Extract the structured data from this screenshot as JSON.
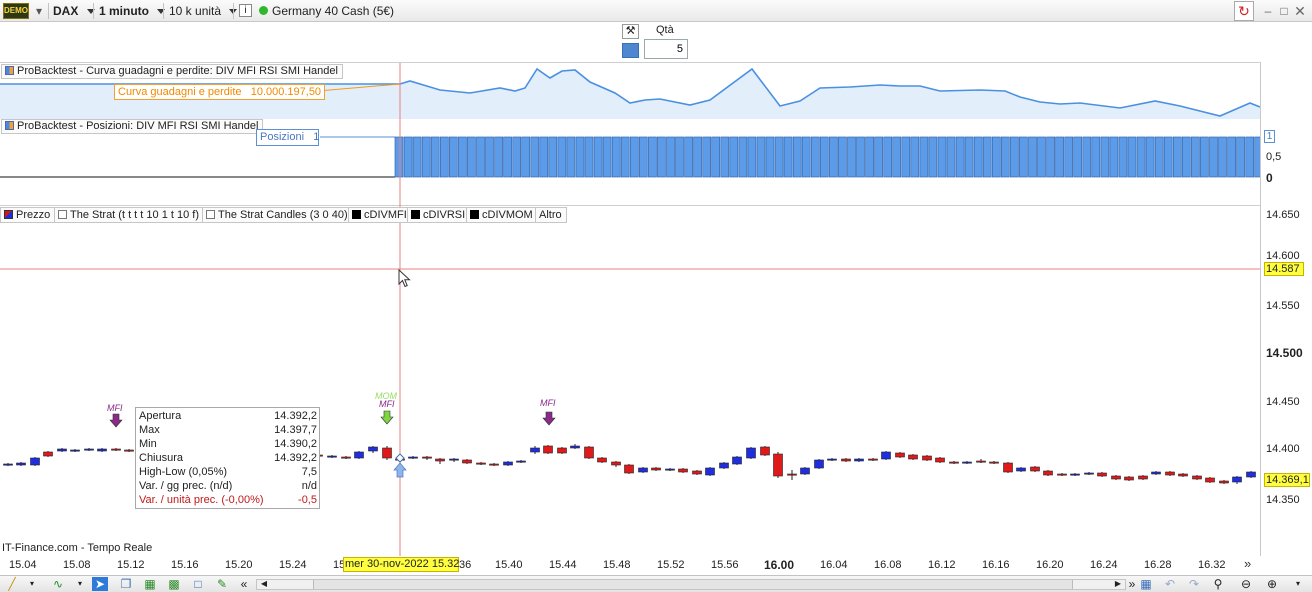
{
  "toolbar": {
    "demo_label": "DEMO",
    "symbol": "DAX",
    "timeframe": "1 minuto",
    "units": "10 k unità",
    "info": "i",
    "instrument": "Germany 40 Cash (5€)",
    "status_color": "#2eb82e"
  },
  "order": {
    "qty_label": "Qtà",
    "qty_value": "5"
  },
  "equity_panel": {
    "title": "ProBacktest - Curva guadagni e perdite: DIV MFI RSI SMI Handel",
    "curve_label": "Curva guadagni e perdite",
    "curve_value": "10.000.197,50",
    "line_color": "#4a90e2",
    "accent_color": "#f49a1a"
  },
  "positions_panel": {
    "title": "ProBacktest - Posizioni: DIV MFI RSI SMI Handel",
    "label": "Posizioni",
    "value": "1",
    "axis": [
      "1",
      "0,5",
      "0"
    ],
    "bar_color": "#5b9be8"
  },
  "price_legend": [
    {
      "icon": "red",
      "label": "Prezzo"
    },
    {
      "icon": "empty",
      "label": "The Strat (t t t t 10 1 t 10 f)"
    },
    {
      "icon": "empty",
      "label": "The Strat Candles (3 0 40)"
    },
    {
      "icon": "black",
      "label": "cDIVMFI"
    },
    {
      "icon": "black",
      "label": "cDIVRSI"
    },
    {
      "icon": "black",
      "label": "cDIVMOM"
    },
    {
      "icon": "none",
      "label": "Altro"
    }
  ],
  "price_axis": {
    "ticks": [
      "14.650",
      "14.600",
      "14.550",
      "14.500",
      "14.450",
      "14.400",
      "14.350"
    ],
    "cursor_price": "14.587",
    "last_price": "14.369,1"
  },
  "tooltip": {
    "rows": [
      {
        "k": "Apertura",
        "v": "14.392,2"
      },
      {
        "k": "Max",
        "v": "14.397,7"
      },
      {
        "k": "Min",
        "v": "14.390,2"
      },
      {
        "k": "Chiusura",
        "v": "14.392,2"
      },
      {
        "k": "High-Low (0,05%)",
        "v": "7,5"
      },
      {
        "k": "Var. / gg prec. (n/d)",
        "v": "n/d"
      },
      {
        "k": "Var. / unità prec. (-0,00%)",
        "v": "-0,5"
      }
    ]
  },
  "signals": {
    "mfi": "MFI",
    "mom": "MOM"
  },
  "footer": {
    "source": "IT-Finance.com - Tempo Reale",
    "cursor_date": "mer 30-nov-2022 15.32"
  },
  "xaxis": {
    "ticks": [
      "15.04",
      "15.08",
      "15.12",
      "15.16",
      "15.20",
      "15.24",
      "15",
      "36",
      "15.40",
      "15.44",
      "15.48",
      "15.52",
      "15.56",
      "16.00",
      "16.04",
      "16.08",
      "16.12",
      "16.16",
      "16.20",
      "16.24",
      "16.28",
      "16.32"
    ],
    "more": "»"
  },
  "bottom_icons": {
    "collapse": "«",
    "expand": "»"
  },
  "colors": {
    "bull": "#1f2fe0",
    "bear": "#e01a1a",
    "cursor": "#e88080",
    "highlight": "#ffff40"
  }
}
